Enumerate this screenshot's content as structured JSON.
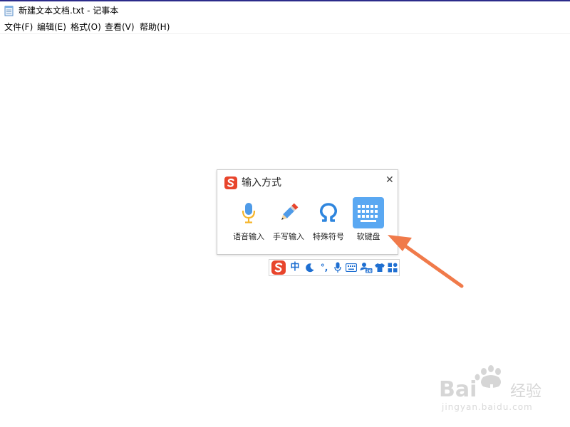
{
  "window": {
    "title": "新建文本文档.txt - 记事本"
  },
  "menu": {
    "items": [
      {
        "label": "文件(F)"
      },
      {
        "label": "编辑(E)"
      },
      {
        "label": "格式(O)"
      },
      {
        "label": "查看(V)"
      },
      {
        "label": "帮助(H)"
      }
    ]
  },
  "popup": {
    "title": "输入方式",
    "close_label": "✕",
    "options": [
      {
        "label": "语音输入",
        "icon": "microphone-icon"
      },
      {
        "label": "手写输入",
        "icon": "pencil-icon"
      },
      {
        "label": "特殊符号",
        "icon": "omega-icon"
      },
      {
        "label": "软键盘",
        "icon": "keyboard-icon",
        "selected": true
      }
    ]
  },
  "toolbar": {
    "items": [
      {
        "name": "sogou-logo-icon"
      },
      {
        "name": "chinese-mode-icon",
        "label": "中"
      },
      {
        "name": "moon-icon"
      },
      {
        "name": "punctuation-icon",
        "label": "°,"
      },
      {
        "name": "microphone-icon"
      },
      {
        "name": "keyboard-icon"
      },
      {
        "name": "user-icon"
      },
      {
        "name": "skin-shirt-icon"
      },
      {
        "name": "grid-menu-icon"
      }
    ]
  },
  "watermark": {
    "logo_text": "Bai du 经验",
    "url_text": "jingyan.baidu.com"
  },
  "colors": {
    "accent_blue": "#1f6fd1",
    "keyboard_blue": "#5aa8f2",
    "sogou_red": "#e8452c",
    "arrow_orange": "#f07a4a",
    "mic_yellow": "#f5b52a"
  }
}
